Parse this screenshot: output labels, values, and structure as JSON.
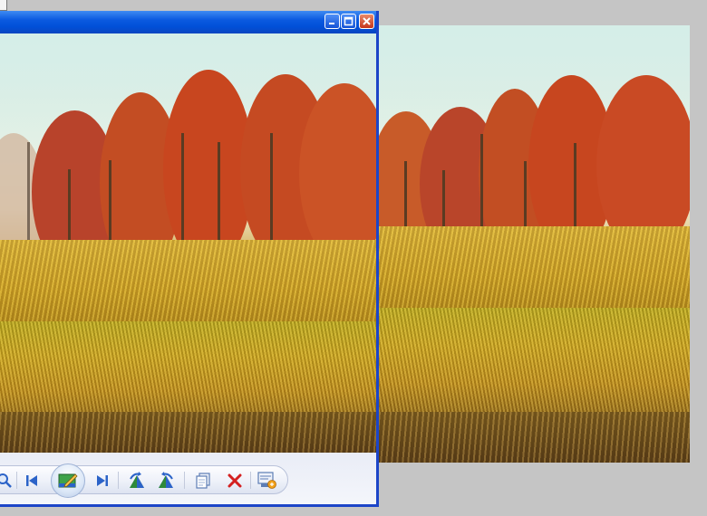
{
  "window": {
    "controls": {
      "minimize_icon": "minimize-icon",
      "maximize_icon": "maximize-icon",
      "close_icon": "close-icon"
    }
  },
  "toolbar": {
    "buttons": [
      {
        "name": "zoom-button",
        "icon": "magnifier-icon"
      },
      {
        "name": "previous-button",
        "icon": "skip-back-icon"
      },
      {
        "name": "edit-button",
        "icon": "edit-picture-icon"
      },
      {
        "name": "next-button",
        "icon": "skip-forward-icon"
      },
      {
        "name": "rotate-clockwise-button",
        "icon": "rotate-clockwise-icon"
      },
      {
        "name": "rotate-counterclockwise-button",
        "icon": "rotate-counterclockwise-icon"
      },
      {
        "name": "copy-button",
        "icon": "copy-icon"
      },
      {
        "name": "delete-button",
        "icon": "delete-icon"
      },
      {
        "name": "properties-button",
        "icon": "properties-icon"
      }
    ]
  },
  "colors": {
    "titlebar": "#0150d8",
    "window_border": "#1c45c8",
    "toolbar_bg": "#eef1f9",
    "delete_red": "#d42020",
    "nav_blue": "#2b63c8",
    "rotate_green": "#2f8a3a"
  }
}
